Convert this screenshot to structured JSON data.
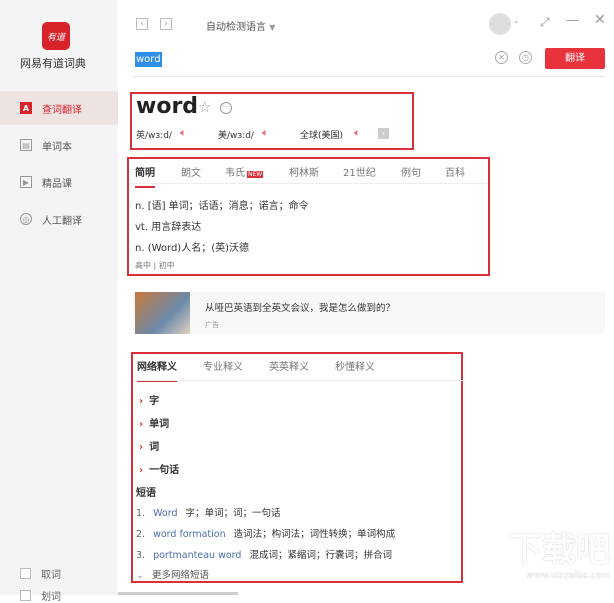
{
  "app": {
    "name": "网易有道词典",
    "logo_text": "有道"
  },
  "sidebar": {
    "items": [
      {
        "label": "查词翻译",
        "icon": "A"
      },
      {
        "label": "单词本",
        "icon": "▤"
      },
      {
        "label": "精品课",
        "icon": "▶"
      },
      {
        "label": "人工翻译",
        "icon": "◎"
      }
    ],
    "bottom": [
      {
        "label": "取词"
      },
      {
        "label": "划词"
      }
    ]
  },
  "toolbar": {
    "language": "自动检测语言",
    "search_value": "word",
    "translate_label": "翻译"
  },
  "word": {
    "headword": "word",
    "pron_uk": "英/wɜːd/",
    "pron_us": "美/wɜːd/",
    "pron_global": "全球(美国)"
  },
  "dict_tabs": [
    {
      "label": "简明"
    },
    {
      "label": "朗文"
    },
    {
      "label": "韦氏",
      "badge": "NEW"
    },
    {
      "label": "柯林斯"
    },
    {
      "label": "21世纪"
    },
    {
      "label": "例句"
    },
    {
      "label": "百科"
    }
  ],
  "definitions": [
    "n. [语] 单词；话语；消息；诺言；命令",
    "vt. 用言辞表达",
    "n. (Word)人名；(英)沃德"
  ],
  "level": "高中 | 初中",
  "ad": {
    "title": "从哑巴英语到全英文会议，我是怎么做到的？",
    "label": "广告"
  },
  "web_tabs": [
    {
      "label": "网络释义"
    },
    {
      "label": "专业释义"
    },
    {
      "label": "英英释义"
    },
    {
      "label": "秒懂释义"
    }
  ],
  "web_meanings": [
    "字",
    "单词",
    "词",
    "一句话"
  ],
  "phrases_title": "短语",
  "phrases": [
    {
      "num": "1.",
      "word": "Word",
      "meaning": "字；单词；词；一句话"
    },
    {
      "num": "2.",
      "word": "word formation",
      "meaning": "造词法；构词法；词性转换；单词构成"
    },
    {
      "num": "3.",
      "word": "portmanteau word",
      "meaning": "混成词；紧缩词；行囊词；拼合词"
    }
  ],
  "more_phrases": "更多网络短语",
  "watermark": "下载吧 www.xiazaiba.com"
}
